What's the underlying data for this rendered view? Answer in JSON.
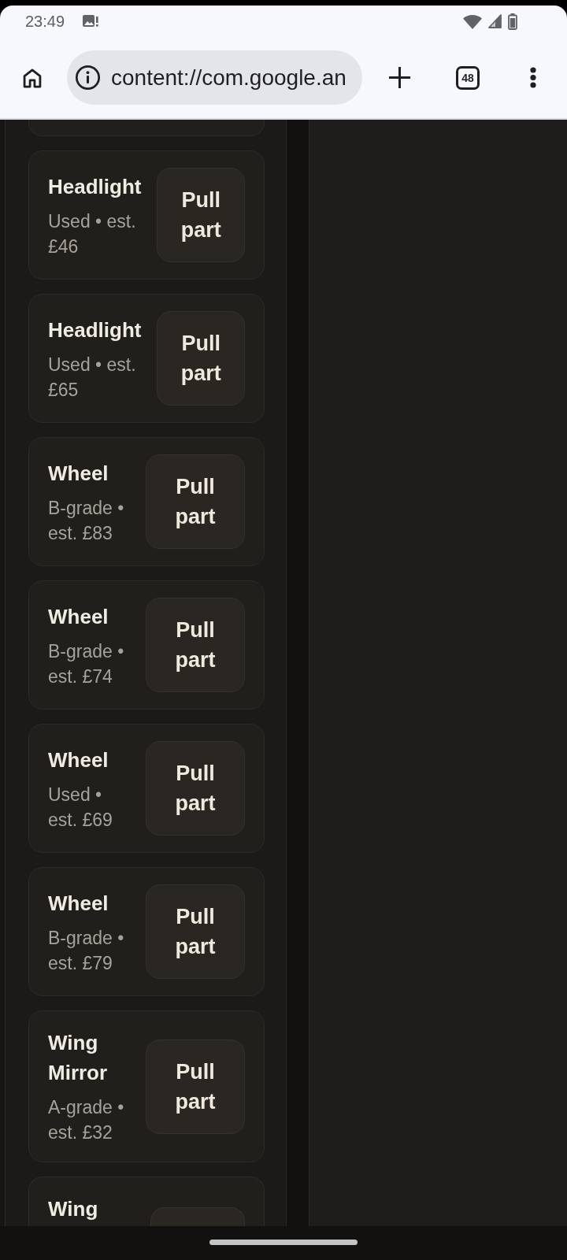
{
  "status_bar": {
    "time": "23:49"
  },
  "browser_toolbar": {
    "url": "content://com.google.an",
    "tab_count": "48"
  },
  "parts_list": [
    {
      "kind": "cut_top"
    },
    {
      "kind": "full",
      "title": "Headlight",
      "detail": "Used • est. £46",
      "button": "Pull part"
    },
    {
      "kind": "full",
      "title": "Headlight",
      "detail": "Used • est. £65",
      "button": "Pull part"
    },
    {
      "kind": "full",
      "title": "Wheel",
      "detail": "B-grade • est. £83",
      "button": "Pull part"
    },
    {
      "kind": "full",
      "title": "Wheel",
      "detail": "B-grade • est. £74",
      "button": "Pull part"
    },
    {
      "kind": "full",
      "title": "Wheel",
      "detail": "Used • est. £69",
      "button": "Pull part"
    },
    {
      "kind": "full",
      "title": "Wheel",
      "detail": "B-grade • est. £79",
      "button": "Pull part"
    },
    {
      "kind": "full",
      "title": "Wing Mirror",
      "detail": "A-grade • est. £32",
      "button": "Pull part"
    },
    {
      "kind": "cut_bottom",
      "title": "Wing"
    }
  ]
}
